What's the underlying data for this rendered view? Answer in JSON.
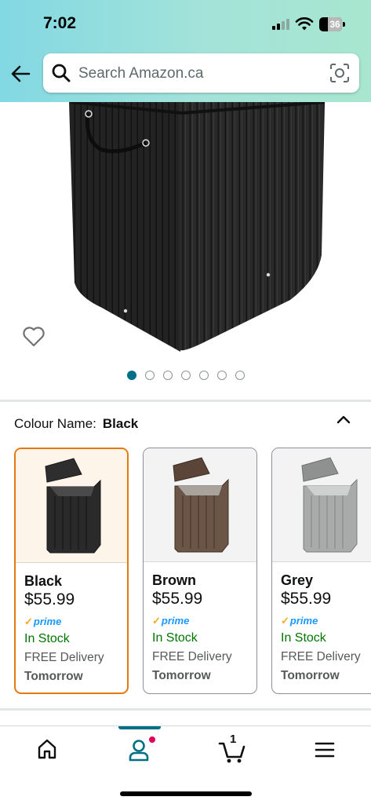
{
  "status_bar": {
    "time": "7:02",
    "battery": "36"
  },
  "search": {
    "placeholder": "Search Amazon.ca"
  },
  "gallery": {
    "dot_count": 7,
    "active_index": 0
  },
  "colour": {
    "label": "Colour Name:",
    "selected": "Black"
  },
  "variants": [
    {
      "name": "Black",
      "price": "$55.99",
      "prime": "prime",
      "stock": "In Stock",
      "delivery": "FREE Delivery",
      "when": "Tomorrow",
      "color": "#2b2b2b"
    },
    {
      "name": "Brown",
      "price": "$55.99",
      "prime": "prime",
      "stock": "In Stock",
      "delivery": "FREE Delivery",
      "when": "Tomorrow",
      "color": "#6b5546"
    },
    {
      "name": "Grey",
      "price": "$55.99",
      "prime": "prime",
      "stock": "In Stock",
      "delivery": "FREE Delivery",
      "when": "Tomorrow",
      "color": "#a9abab"
    }
  ],
  "bottom_nav": {
    "cart_count": "1",
    "items": [
      "home-icon",
      "account-icon",
      "cart-icon",
      "menu-icon"
    ]
  },
  "colors": {
    "accent": "#007185",
    "selected_border": "#e47911",
    "in_stock": "#007600",
    "prime": "#1a98ff"
  }
}
